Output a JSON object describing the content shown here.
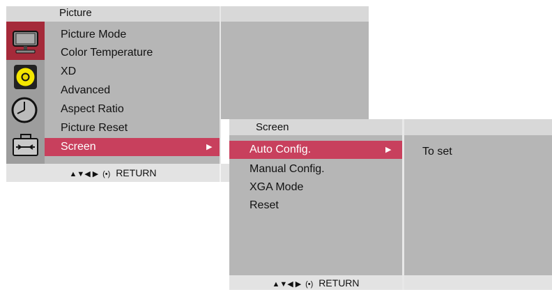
{
  "main_menu": {
    "title": "Picture",
    "items": [
      {
        "label": "Picture Mode"
      },
      {
        "label": "Color Temperature"
      },
      {
        "label": "XD"
      },
      {
        "label": "Advanced"
      },
      {
        "label": "Aspect Ratio"
      },
      {
        "label": "Picture Reset"
      },
      {
        "label": "Screen",
        "selected": true
      }
    ],
    "footer_arrows": "▲▼◀ ▶",
    "footer_ok": "(•)",
    "footer_return": "RETURN",
    "icons": [
      "picture-icon",
      "audio-icon",
      "time-icon",
      "option-icon"
    ]
  },
  "sub_menu": {
    "title": "Screen",
    "items": [
      {
        "label": "Auto Config.",
        "selected": true
      },
      {
        "label": "Manual Config."
      },
      {
        "label": "XGA Mode"
      },
      {
        "label": "Reset"
      }
    ],
    "info": "To set",
    "footer_arrows": "▲▼◀ ▶",
    "footer_ok": "(•)",
    "footer_return": "RETURN"
  },
  "colors": {
    "panel": "#b6b6b6",
    "header": "#d8d8d8",
    "selected": "#c8405d",
    "footer": "#e3e3e3"
  }
}
